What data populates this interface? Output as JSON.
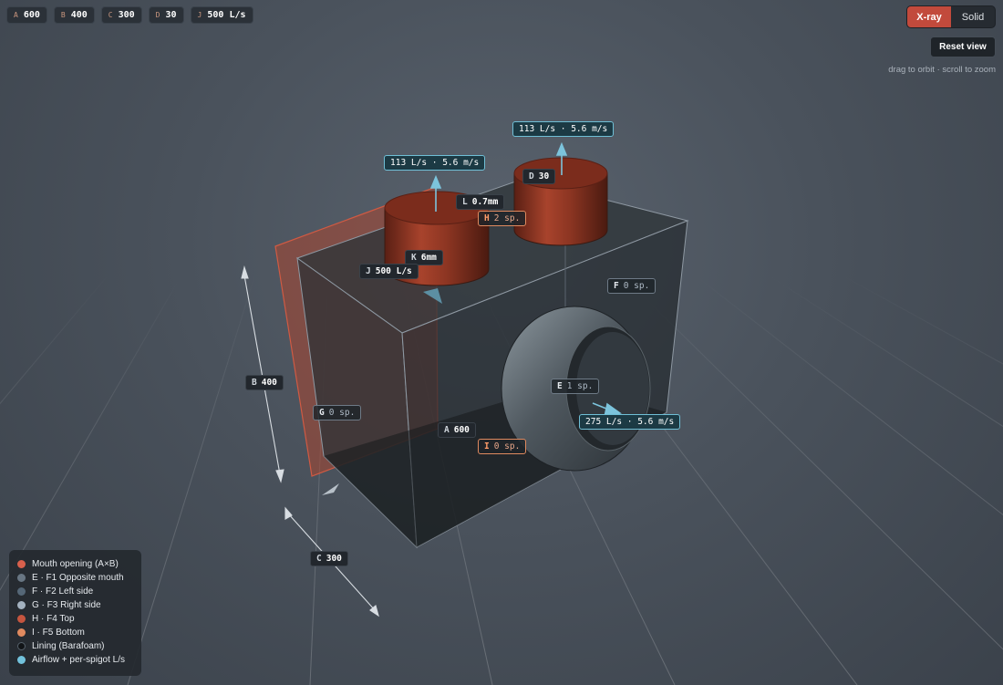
{
  "dims": [
    {
      "key": "A",
      "value": "600"
    },
    {
      "key": "B",
      "value": "400"
    },
    {
      "key": "C",
      "value": "300"
    },
    {
      "key": "D",
      "value": "30"
    },
    {
      "key": "J",
      "value": "500 L/s"
    }
  ],
  "view_mode": {
    "options": [
      "X-ray",
      "Solid"
    ],
    "selected": "X-ray"
  },
  "reset_label": "Reset view",
  "hint": "drag to orbit · scroll to zoom",
  "scene": {
    "flow_top_left": "113 L/s · 5.6 m/s",
    "flow_top_right": "113 L/s · 5.6 m/s",
    "flow_side": "275 L/s · 5.6 m/s",
    "d_label": {
      "key": "D",
      "value": "30"
    },
    "l_label": {
      "key": "L",
      "value": "0.7mm"
    },
    "h_label": {
      "key": "H",
      "value": "2 sp."
    },
    "k_label": {
      "key": "K",
      "value": "6mm"
    },
    "j_label": {
      "key": "J",
      "value": "500 L/s"
    },
    "f_label": {
      "key": "F",
      "value": "0 sp."
    },
    "b_label": {
      "key": "B",
      "value": "400"
    },
    "e_label": {
      "key": "E",
      "value": "1 sp."
    },
    "g_label": {
      "key": "G",
      "value": "0 sp."
    },
    "a_label": {
      "key": "A",
      "value": "600"
    },
    "i_label": {
      "key": "I",
      "value": "0 sp."
    },
    "c_label": {
      "key": "C",
      "value": "300"
    }
  },
  "legend": [
    {
      "label": "Mouth opening (A×B)",
      "color": "#d8604c"
    },
    {
      "label": "E · F1 Opposite mouth",
      "color": "#687683"
    },
    {
      "label": "F · F2 Left side",
      "color": "#556777"
    },
    {
      "label": "G · F3 Right side",
      "color": "#a3b1bf"
    },
    {
      "label": "H · F4 Top",
      "color": "#c5553f"
    },
    {
      "label": "I · F5 Bottom",
      "color": "#e08a5f"
    },
    {
      "label": "Lining (Barafoam)",
      "color": "#111417"
    },
    {
      "label": "Airflow + per-spigot L/s",
      "color": "#72c2dc"
    }
  ],
  "colors": {
    "accent": "#c24a3c",
    "flow": "#6fbfd6",
    "spigot": "#8e3422"
  }
}
